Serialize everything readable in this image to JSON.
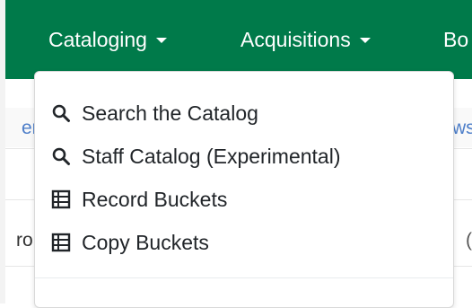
{
  "navbar": {
    "items": [
      {
        "label": "Cataloging"
      },
      {
        "label": "Acquisitions"
      },
      {
        "label": "Bo"
      }
    ]
  },
  "background": {
    "fragment_left_1": "er",
    "fragment_left_2": "ro",
    "fragment_right_1": "ws",
    "fragment_right_2": "("
  },
  "cataloging_menu": {
    "items": [
      {
        "label": "Search the Catalog",
        "icon": "search-icon"
      },
      {
        "label": "Staff Catalog (Experimental)",
        "icon": "search-icon"
      },
      {
        "label": "Record Buckets",
        "icon": "table-icon"
      },
      {
        "label": "Copy Buckets",
        "icon": "table-icon"
      }
    ]
  },
  "colors": {
    "navbar_bg": "#007a4a",
    "link_blue": "#4d7ec9"
  }
}
